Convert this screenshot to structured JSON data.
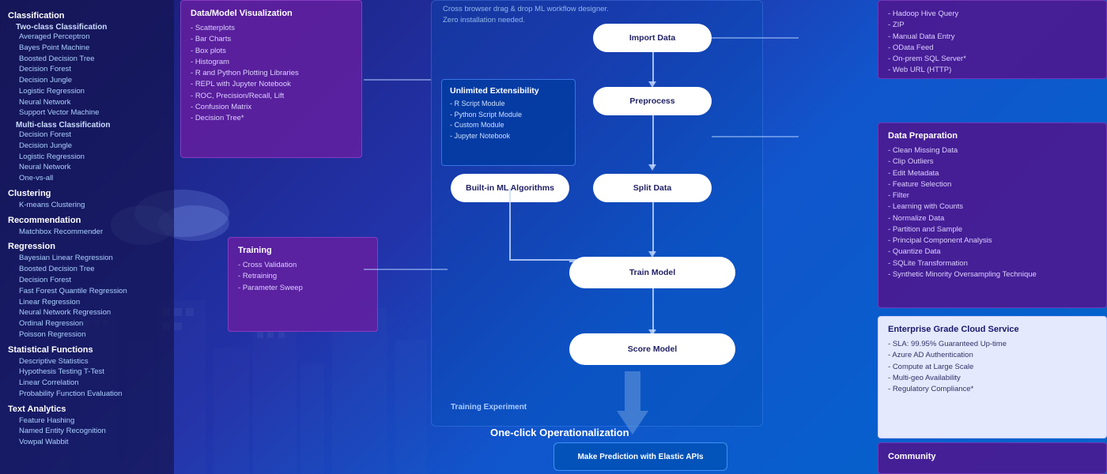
{
  "leftPanel": {
    "sections": [
      {
        "title": "Classification",
        "subsections": [
          {
            "title": "Two-class Classification",
            "items": [
              "Averaged Perceptron",
              "Bayes Point Machine",
              "Boosted Decision Tree",
              "Decision Forest",
              "Decision Jungle",
              "Logistic Regression",
              "Neural Network",
              "Support Vector Machine"
            ]
          },
          {
            "title": "Multi-class Classification",
            "items": [
              "Decision Forest",
              "Decision Jungle",
              "Logistic Regression",
              "Neural Network",
              "One-vs-all"
            ]
          }
        ]
      },
      {
        "title": "Clustering",
        "subsections": [
          {
            "title": "",
            "items": [
              "K-means Clustering"
            ]
          }
        ]
      },
      {
        "title": "Recommendation",
        "subsections": [
          {
            "title": "",
            "items": [
              "Matchbox Recommender"
            ]
          }
        ]
      },
      {
        "title": "Regression",
        "subsections": [
          {
            "title": "",
            "items": [
              "Bayesian Linear Regression",
              "Boosted Decision Tree",
              "Decision Forest",
              "Fast Forest Quantile Regression",
              "Linear Regression",
              "Neural Network Regression",
              "Ordinal Regression",
              "Poisson Regression"
            ]
          }
        ]
      },
      {
        "title": "Statistical Functions",
        "subsections": [
          {
            "title": "",
            "items": [
              "Descriptive Statistics",
              "Hypothesis Testing T-Test",
              "Linear Correlation",
              "Probability Function Evaluation"
            ]
          }
        ]
      },
      {
        "title": "Text Analytics",
        "subsections": [
          {
            "title": "",
            "items": [
              "Feature Hashing",
              "Named Entity Recognition",
              "Vowpal Wabbit"
            ]
          }
        ]
      }
    ]
  },
  "visualizationBox": {
    "title": "Data/Model Visualization",
    "items": [
      "Scatterplots",
      "Bar Charts",
      "Box plots",
      "Histogram",
      "R and Python Plotting Libraries",
      "REPL with Jupyter Notebook",
      "ROC, Precision/Recall, Lift",
      "Confusion Matrix",
      "Decision Tree*"
    ]
  },
  "trainingBox": {
    "title": "Training",
    "items": [
      "Cross Validation",
      "Retraining",
      "Parameter Sweep"
    ]
  },
  "unlimitedBox": {
    "title": "Unlimited Extensibility",
    "items": [
      "R Script Module",
      "Python Script Module",
      "Custom Module",
      "Jupyter Notebook"
    ]
  },
  "topDesc": {
    "line1": "Cross browser drag & drop ML workflow designer.",
    "line2": "Zero installation needed."
  },
  "flowNodes": {
    "importData": "Import Data",
    "preprocess": "Preprocess",
    "builtInML": "Built-in ML Algorithms",
    "splitData": "Split Data",
    "trainModel": "Train Model",
    "scoreModel": "Score Model",
    "trainingExperiment": "Training Experiment"
  },
  "rightTopBox": {
    "items": [
      "Hadoop Hive Query",
      "ZIP",
      "Manual Data Entry",
      "OData Feed",
      "On-prem SQL Server*",
      "Web URL (HTTP)"
    ]
  },
  "dataPreparationBox": {
    "title": "Data Preparation",
    "items": [
      "Clean Missing Data",
      "Clip Outliers",
      "Edit Metadata",
      "Feature Selection",
      "Filter",
      "Learning with Counts",
      "Normalize Data",
      "Partition and Sample",
      "Principal Component Analysis",
      "Quantize Data",
      "SQLite Transformation",
      "Synthetic Minority Oversampling Technique"
    ]
  },
  "enterpriseBox": {
    "title": "Enterprise Grade Cloud Service",
    "items": [
      "SLA: 99.95% Guaranteed Up-time",
      "Azure AD Authentication",
      "Compute at Large Scale",
      "Multi-geo Availability",
      "Regulatory Compliance*"
    ]
  },
  "operationalization": {
    "label": "One-click Operationalization"
  },
  "predictionBox": {
    "label": "Make Prediction with Elastic APIs"
  },
  "communityBox": {
    "title": "Community"
  }
}
